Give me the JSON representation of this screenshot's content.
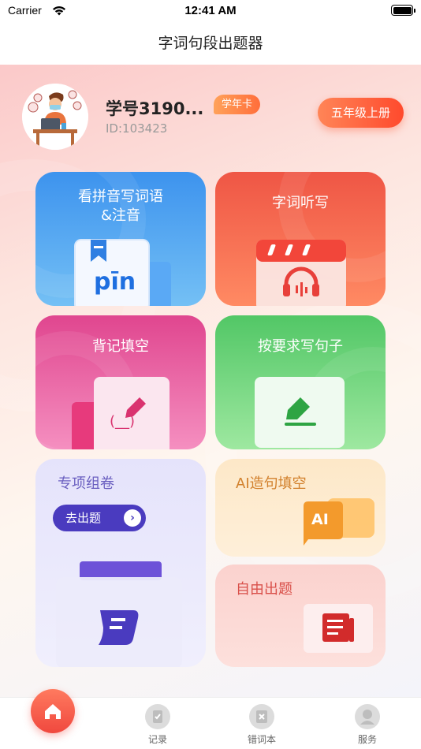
{
  "status_bar": {
    "carrier": "Carrier",
    "time": "12:41 AM"
  },
  "nav": {
    "title": "字词句段出题器"
  },
  "profile": {
    "username": "学号3190...",
    "badge": "学年卡",
    "id_text": "ID:103423",
    "grade_button": "五年级上册"
  },
  "cards": {
    "pinyin": {
      "label_line1": "看拼音写词语",
      "label_line2": "&注音",
      "illustration_text": "pīn"
    },
    "dictation": {
      "label": "字词听写"
    },
    "memorize": {
      "label": "背记填空",
      "illustration_text": "(__)"
    },
    "sentence": {
      "label": "按要求写句子"
    },
    "special": {
      "label": "专项组卷",
      "button": "去出题"
    },
    "ai": {
      "label": "AI造句填空",
      "illustration_text": "AI"
    },
    "free": {
      "label": "自由出题"
    }
  },
  "tabbar": {
    "tabs": [
      {
        "label": "记录",
        "icon": "record-icon"
      },
      {
        "label": "错词本",
        "icon": "wrong-words-icon"
      },
      {
        "label": "服务",
        "icon": "service-icon"
      }
    ],
    "home_icon": "home-icon"
  },
  "colors": {
    "accent": "#ff4a2d",
    "brand_purple": "#4a3bbf"
  }
}
